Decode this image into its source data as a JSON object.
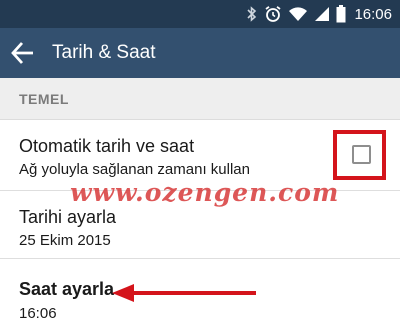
{
  "status_bar": {
    "time": "16:06",
    "icons": [
      "bluetooth-icon",
      "alarm-icon",
      "wifi-icon",
      "signal-icon",
      "battery-icon"
    ]
  },
  "app_bar": {
    "title": "Tarih & Saat",
    "back_icon": "arrow-left-icon"
  },
  "section": {
    "label": "TEMEL"
  },
  "settings": {
    "auto_datetime": {
      "title": "Otomatik tarih ve saat",
      "subtitle": "Ağ yoluyla sağlanan zamanı kullan",
      "checked": false
    },
    "set_date": {
      "title": "Tarihi ayarla",
      "value": "25 Ekim 2015"
    },
    "set_time": {
      "title": "Saat ayarla",
      "value": "16:06"
    }
  },
  "watermark": "www.ozengen.com",
  "colors": {
    "status_bar": "#233a52",
    "app_bar": "#33506f",
    "annotation_red": "#d4141b",
    "section_bg": "#eeeeee"
  }
}
